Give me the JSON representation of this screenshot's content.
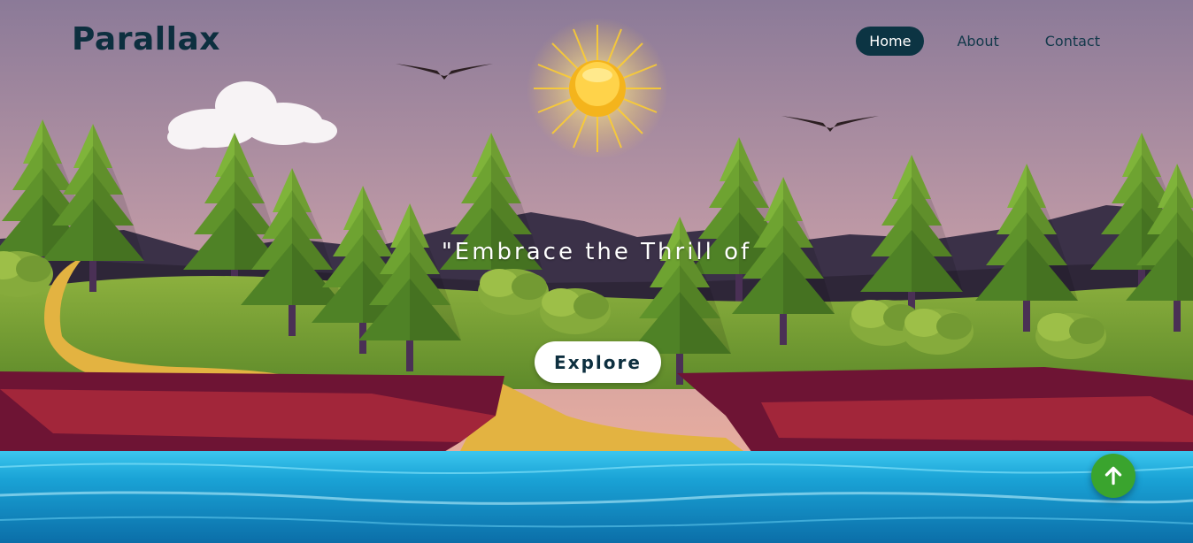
{
  "header": {
    "logo": "Parallax",
    "nav": [
      {
        "label": "Home",
        "active": true
      },
      {
        "label": "About",
        "active": false
      },
      {
        "label": "Contact",
        "active": false
      }
    ]
  },
  "hero": {
    "headline": "\"Embrace the Thrill of",
    "button_label": "Explore"
  },
  "scroll_top": {
    "icon": "arrow-up-icon"
  },
  "colors": {
    "brand_dark": "#0c3443",
    "sky_top": "#8e7c97",
    "sky_bottom": "#e0a8a2",
    "grass": "#7da33a",
    "cliff": "#7a1836",
    "water": "#1b9fd0",
    "scroll_button": "#3aa42e"
  }
}
